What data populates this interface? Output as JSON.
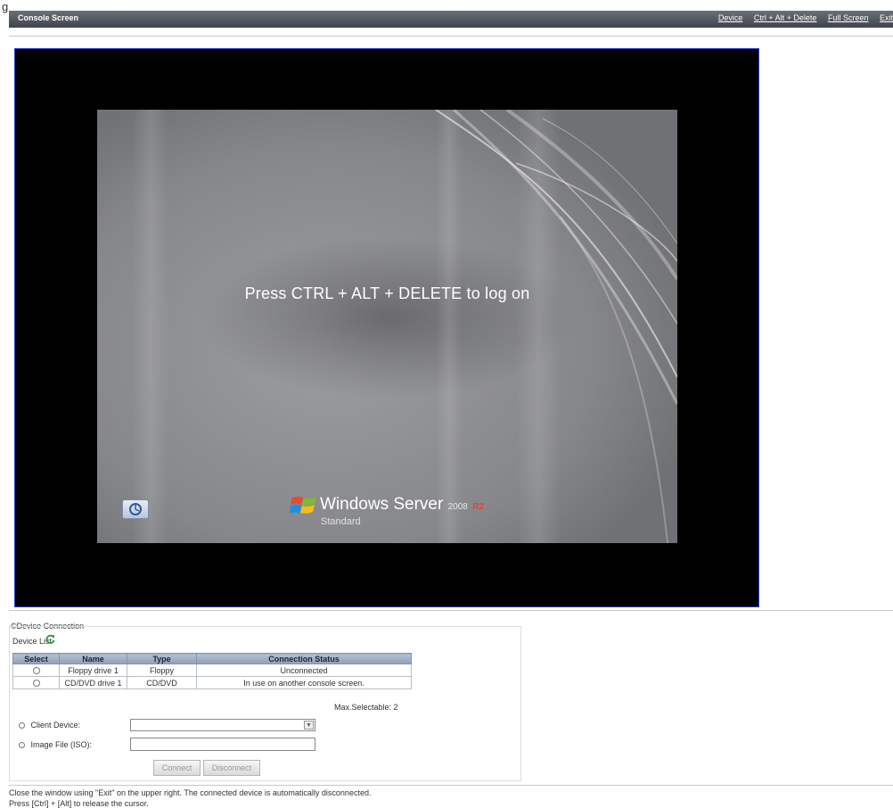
{
  "figure_label": "g",
  "window": {
    "title": "Console Screen",
    "menu": [
      "Device",
      "Ctrl + Alt + Delete",
      "Full Screen",
      "Exit"
    ]
  },
  "login_screen": {
    "message": "Press CTRL + ALT + DELETE to log on",
    "product": "Windows Server",
    "year": "2008",
    "release": "R2",
    "edition": "Standard"
  },
  "device_connection": {
    "section_title": "©Device Connection",
    "list_label": "Device List",
    "columns": [
      "Select",
      "Name",
      "Type",
      "Connection Status"
    ],
    "rows": [
      {
        "name": "Floppy drive 1",
        "type": "Floppy",
        "status": "Unconnected"
      },
      {
        "name": "CD/DVD drive 1",
        "type": "CD/DVD",
        "status": "In use on another console screen."
      }
    ],
    "max_selectable": "Max.Selectable: 2",
    "client_device_label": "Client Device:",
    "client_device_value": "",
    "image_file_label": "Image File (ISO):",
    "image_file_value": "",
    "connect_label": "Connect",
    "disconnect_label": "Disconnect"
  },
  "footer": {
    "line1": "Close the window using \"Exit\" on the upper right. The connected device is automatically disconnected.",
    "line2": "Press [Ctrl] + [Alt] to release the cursor."
  },
  "colors": {
    "title_bar": "#4a4f57",
    "console_border": "#2a3fcf",
    "table_header": "#9fadc2"
  }
}
